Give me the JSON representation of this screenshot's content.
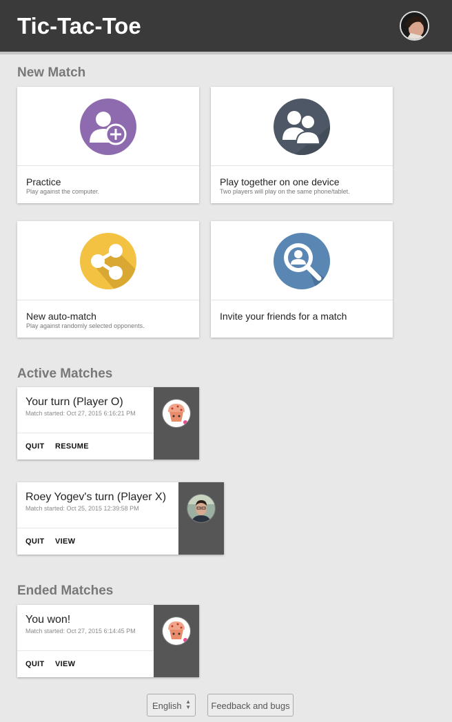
{
  "header": {
    "title": "Tic-Tac-Toe"
  },
  "sections": {
    "new_match": "New Match",
    "active_matches": "Active Matches",
    "ended_matches": "Ended Matches"
  },
  "new_match_cards": [
    {
      "label": "Practice",
      "sub": "Play against the computer.",
      "icon": "user-add-icon",
      "color": "#8e6aaf"
    },
    {
      "label": "Play together on one device",
      "sub": "Two players will play on the same phone/tablet.",
      "icon": "two-users-icon",
      "color": "#4d5766"
    },
    {
      "label": "New auto-match",
      "sub": "Play against randomly selected opponents.",
      "icon": "share-icon",
      "color": "#f3c242"
    },
    {
      "label": "Invite your friends for a match",
      "sub": "",
      "icon": "search-user-icon",
      "color": "#5a86b3"
    }
  ],
  "active_matches": [
    {
      "title": "Your turn (Player O)",
      "date": "Match started: Oct 27, 2015 6:16:21 PM",
      "buttons": [
        "QUIT",
        "RESUME"
      ],
      "avatar": "muffin-avatar"
    },
    {
      "title": "Roey Yogev's turn (Player X)",
      "date": "Match started: Oct 25, 2015 12:39:58 PM",
      "buttons": [
        "QUIT",
        "VIEW"
      ],
      "avatar": "person-avatar"
    }
  ],
  "ended_matches": [
    {
      "title": "You won!",
      "date": "Match started: Oct 27, 2015 6:14:45 PM",
      "buttons": [
        "QUIT",
        "VIEW"
      ],
      "avatar": "muffin-avatar"
    }
  ],
  "footer": {
    "language": "English",
    "feedback": "Feedback and bugs"
  }
}
